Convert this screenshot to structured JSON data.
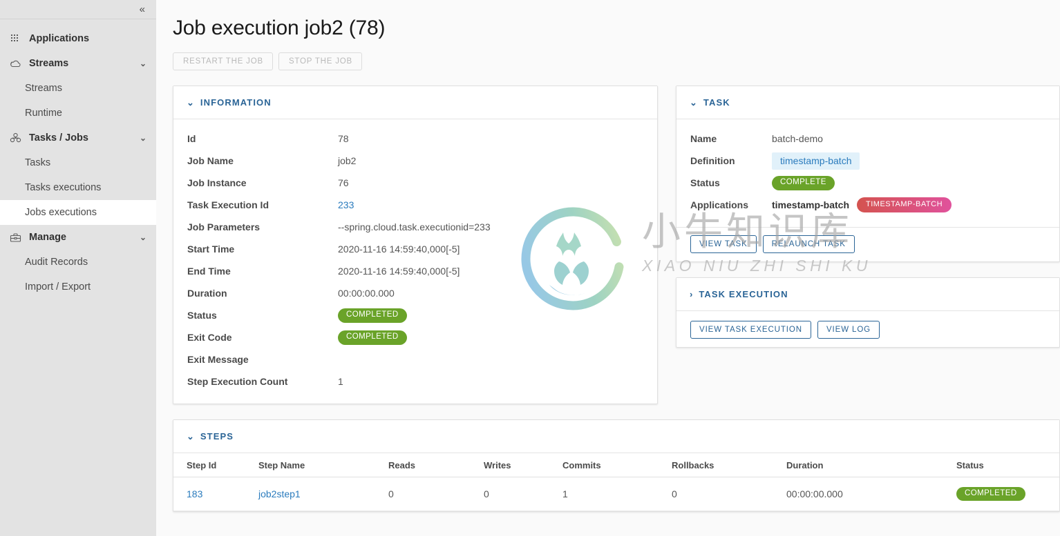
{
  "sidebar": {
    "collapse_icon": "chevron-double-left",
    "groups": [
      {
        "label": "Applications",
        "icon": "grid-icon",
        "chevron": null
      },
      {
        "label": "Streams",
        "icon": "cloud-icon",
        "chevron": "v"
      },
      {
        "label": "Tasks / Jobs",
        "icon": "tasks-icon",
        "chevron": "v"
      },
      {
        "label": "Manage",
        "icon": "briefcase-icon",
        "chevron": "v"
      }
    ],
    "items": [
      {
        "label": "Streams",
        "active": false
      },
      {
        "label": "Runtime",
        "active": false
      },
      {
        "label": "Tasks",
        "active": false
      },
      {
        "label": "Tasks executions",
        "active": false
      },
      {
        "label": "Jobs executions",
        "active": true
      },
      {
        "label": "Audit Records",
        "active": false
      },
      {
        "label": "Import / Export",
        "active": false
      }
    ]
  },
  "page": {
    "title": "Job execution job2 (78)",
    "actions": [
      {
        "label": "Restart the job",
        "disabled": true
      },
      {
        "label": "Stop the job",
        "disabled": true
      }
    ]
  },
  "information": {
    "header": "INFORMATION",
    "expanded": true,
    "rows": [
      {
        "key": "Id",
        "value": "78",
        "type": "text"
      },
      {
        "key": "Job Name",
        "value": "job2",
        "type": "text"
      },
      {
        "key": "Job Instance",
        "value": "76",
        "type": "text"
      },
      {
        "key": "Task Execution Id",
        "value": "233",
        "type": "link"
      },
      {
        "key": "Job Parameters",
        "value": "--spring.cloud.task.executionid=233",
        "type": "text"
      },
      {
        "key": "Start Time",
        "value": "2020-11-16 14:59:40,000[-5]",
        "type": "text"
      },
      {
        "key": "End Time",
        "value": "2020-11-16 14:59:40,000[-5]",
        "type": "text"
      },
      {
        "key": "Duration",
        "value": "00:00:00.000",
        "type": "text"
      },
      {
        "key": "Status",
        "value": "COMPLETED",
        "type": "badge-green"
      },
      {
        "key": "Exit Code",
        "value": "COMPLETED",
        "type": "badge-green"
      },
      {
        "key": "Exit Message",
        "value": "",
        "type": "text"
      },
      {
        "key": "Step Execution Count",
        "value": "1",
        "type": "text"
      }
    ]
  },
  "task": {
    "header": "TASK",
    "expanded": true,
    "name_label": "Name",
    "name_value": "batch-demo",
    "definition_label": "Definition",
    "definition_value": "timestamp-batch",
    "status_label": "Status",
    "status_value": "COMPLETE",
    "applications_label": "Applications",
    "applications_value": "timestamp-batch",
    "applications_badge": "TIMESTAMP-BATCH",
    "buttons": [
      {
        "label": "View task"
      },
      {
        "label": "Relaunch task"
      }
    ]
  },
  "task_execution": {
    "header": "TASK EXECUTION",
    "expanded": false,
    "buttons": [
      {
        "label": "View task execution"
      },
      {
        "label": "View log"
      }
    ]
  },
  "steps": {
    "header": "STEPS",
    "expanded": true,
    "columns": [
      "Step Id",
      "Step Name",
      "Reads",
      "Writes",
      "Commits",
      "Rollbacks",
      "Duration",
      "Status"
    ],
    "rows": [
      {
        "step_id": "183",
        "step_name": "job2step1",
        "reads": "0",
        "writes": "0",
        "commits": "1",
        "rollbacks": "0",
        "duration": "00:00:00.000",
        "status": "COMPLETED"
      }
    ]
  },
  "watermark": {
    "cn": "小牛知识库",
    "pinyin": "XIAO NIU ZHI SHI KU"
  },
  "colors": {
    "accent_blue": "#2a6496",
    "link_blue": "#2a7bbd",
    "status_green": "#6aa329",
    "chip_bg": "#e1f1fa",
    "badge_gradient_start": "#d4534f",
    "badge_gradient_end": "#e0529c",
    "sidebar_bg": "#e3e3e3",
    "page_bg": "#fafafa"
  }
}
